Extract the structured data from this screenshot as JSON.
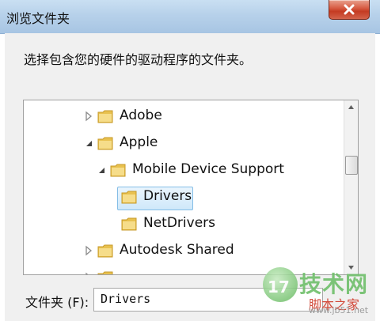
{
  "window": {
    "title": "浏览文件夹",
    "close_icon": "close-x-icon"
  },
  "description": "选择包含您的硬件的驱动程序的文件夹。",
  "tree": {
    "items": [
      {
        "label": "Adobe",
        "expander": "collapsed",
        "selected": false
      },
      {
        "label": "Apple",
        "expander": "expanded",
        "selected": false
      },
      {
        "label": "Mobile Device Support",
        "expander": "expanded",
        "selected": false
      },
      {
        "label": "Drivers",
        "expander": "none",
        "selected": true
      },
      {
        "label": "NetDrivers",
        "expander": "none",
        "selected": false
      },
      {
        "label": "Autodesk Shared",
        "expander": "collapsed",
        "selected": false
      },
      {
        "label": "",
        "expander": "collapsed",
        "selected": false
      }
    ],
    "icons": {
      "folder": "folder-icon",
      "collapsed": "triangle-right-icon",
      "expanded": "triangle-down-icon"
    },
    "scrollbar_position": 0.35
  },
  "folder_field": {
    "label": "文件夹 (F):",
    "value": "Drivers"
  },
  "watermark": {
    "logo_text": "17",
    "title": "技术网",
    "subtitle": "脚本之家",
    "url": "www.jb51.net"
  },
  "colors": {
    "titlebar": "#b7d1ea",
    "selection": "#cfe8fa",
    "selection_border": "#84bde6",
    "folder": "#e8c14f"
  }
}
